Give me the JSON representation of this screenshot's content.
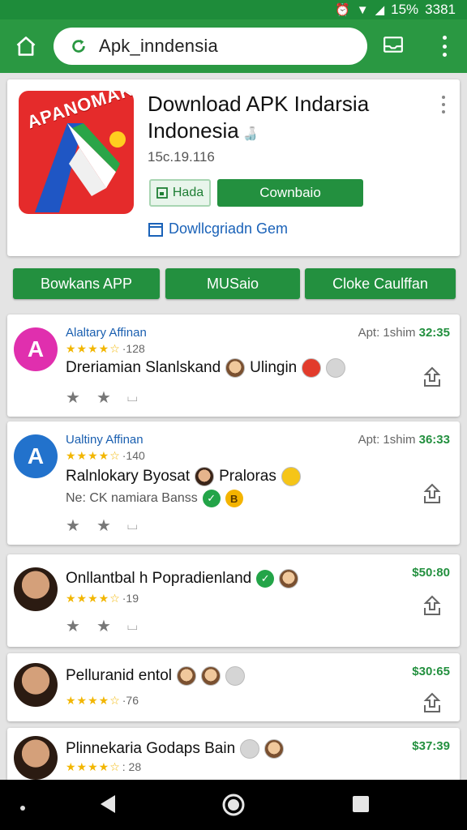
{
  "status": {
    "battery": "15%",
    "time": "3381"
  },
  "toolbar": {
    "url": "Apk_inndensia"
  },
  "app": {
    "brand": "APANOMAK",
    "title": "Download APK Indarsia Indonesia",
    "version": "15c.19.116",
    "btn_hada": "Hada",
    "btn_download": "Cownbaio",
    "link": "Dowllcgriadn Gem"
  },
  "tabs": [
    "Bowkans APP",
    "MUSaio",
    "Cloke Caulffan"
  ],
  "rows": [
    {
      "author": "Alaltary Affinan",
      "rating": "★★★★☆",
      "count": "·128",
      "text": "Dreriamian Slanlskand",
      "text2": "Ulingin",
      "meta": "Apt: 1shim",
      "time": "32:35",
      "avatar_color": "#e02fae",
      "avatar_letter": "A"
    },
    {
      "author": "Ualtiny Affinan",
      "rating": "★★★★☆",
      "count": "·140",
      "text": "Ralnlokary Byosat",
      "text2": "Praloras",
      "sub": "Ne: CK namiara Banss",
      "meta": "Apt: 1shim",
      "time": "36:33",
      "avatar_color": "#2272cc",
      "avatar_letter": "A"
    },
    {
      "rating": "★★★★☆",
      "count": "·19",
      "text": "Onllantbal h Popradienland",
      "price": "$50:80"
    },
    {
      "rating": "★★★★☆",
      "count": "·76",
      "text": "Pelluranid entol",
      "price": "$30:65"
    },
    {
      "rating": "★★★★☆",
      "count": ": 28",
      "text": "Plinnekaria Godaps Bain",
      "price": "$37:39"
    }
  ]
}
